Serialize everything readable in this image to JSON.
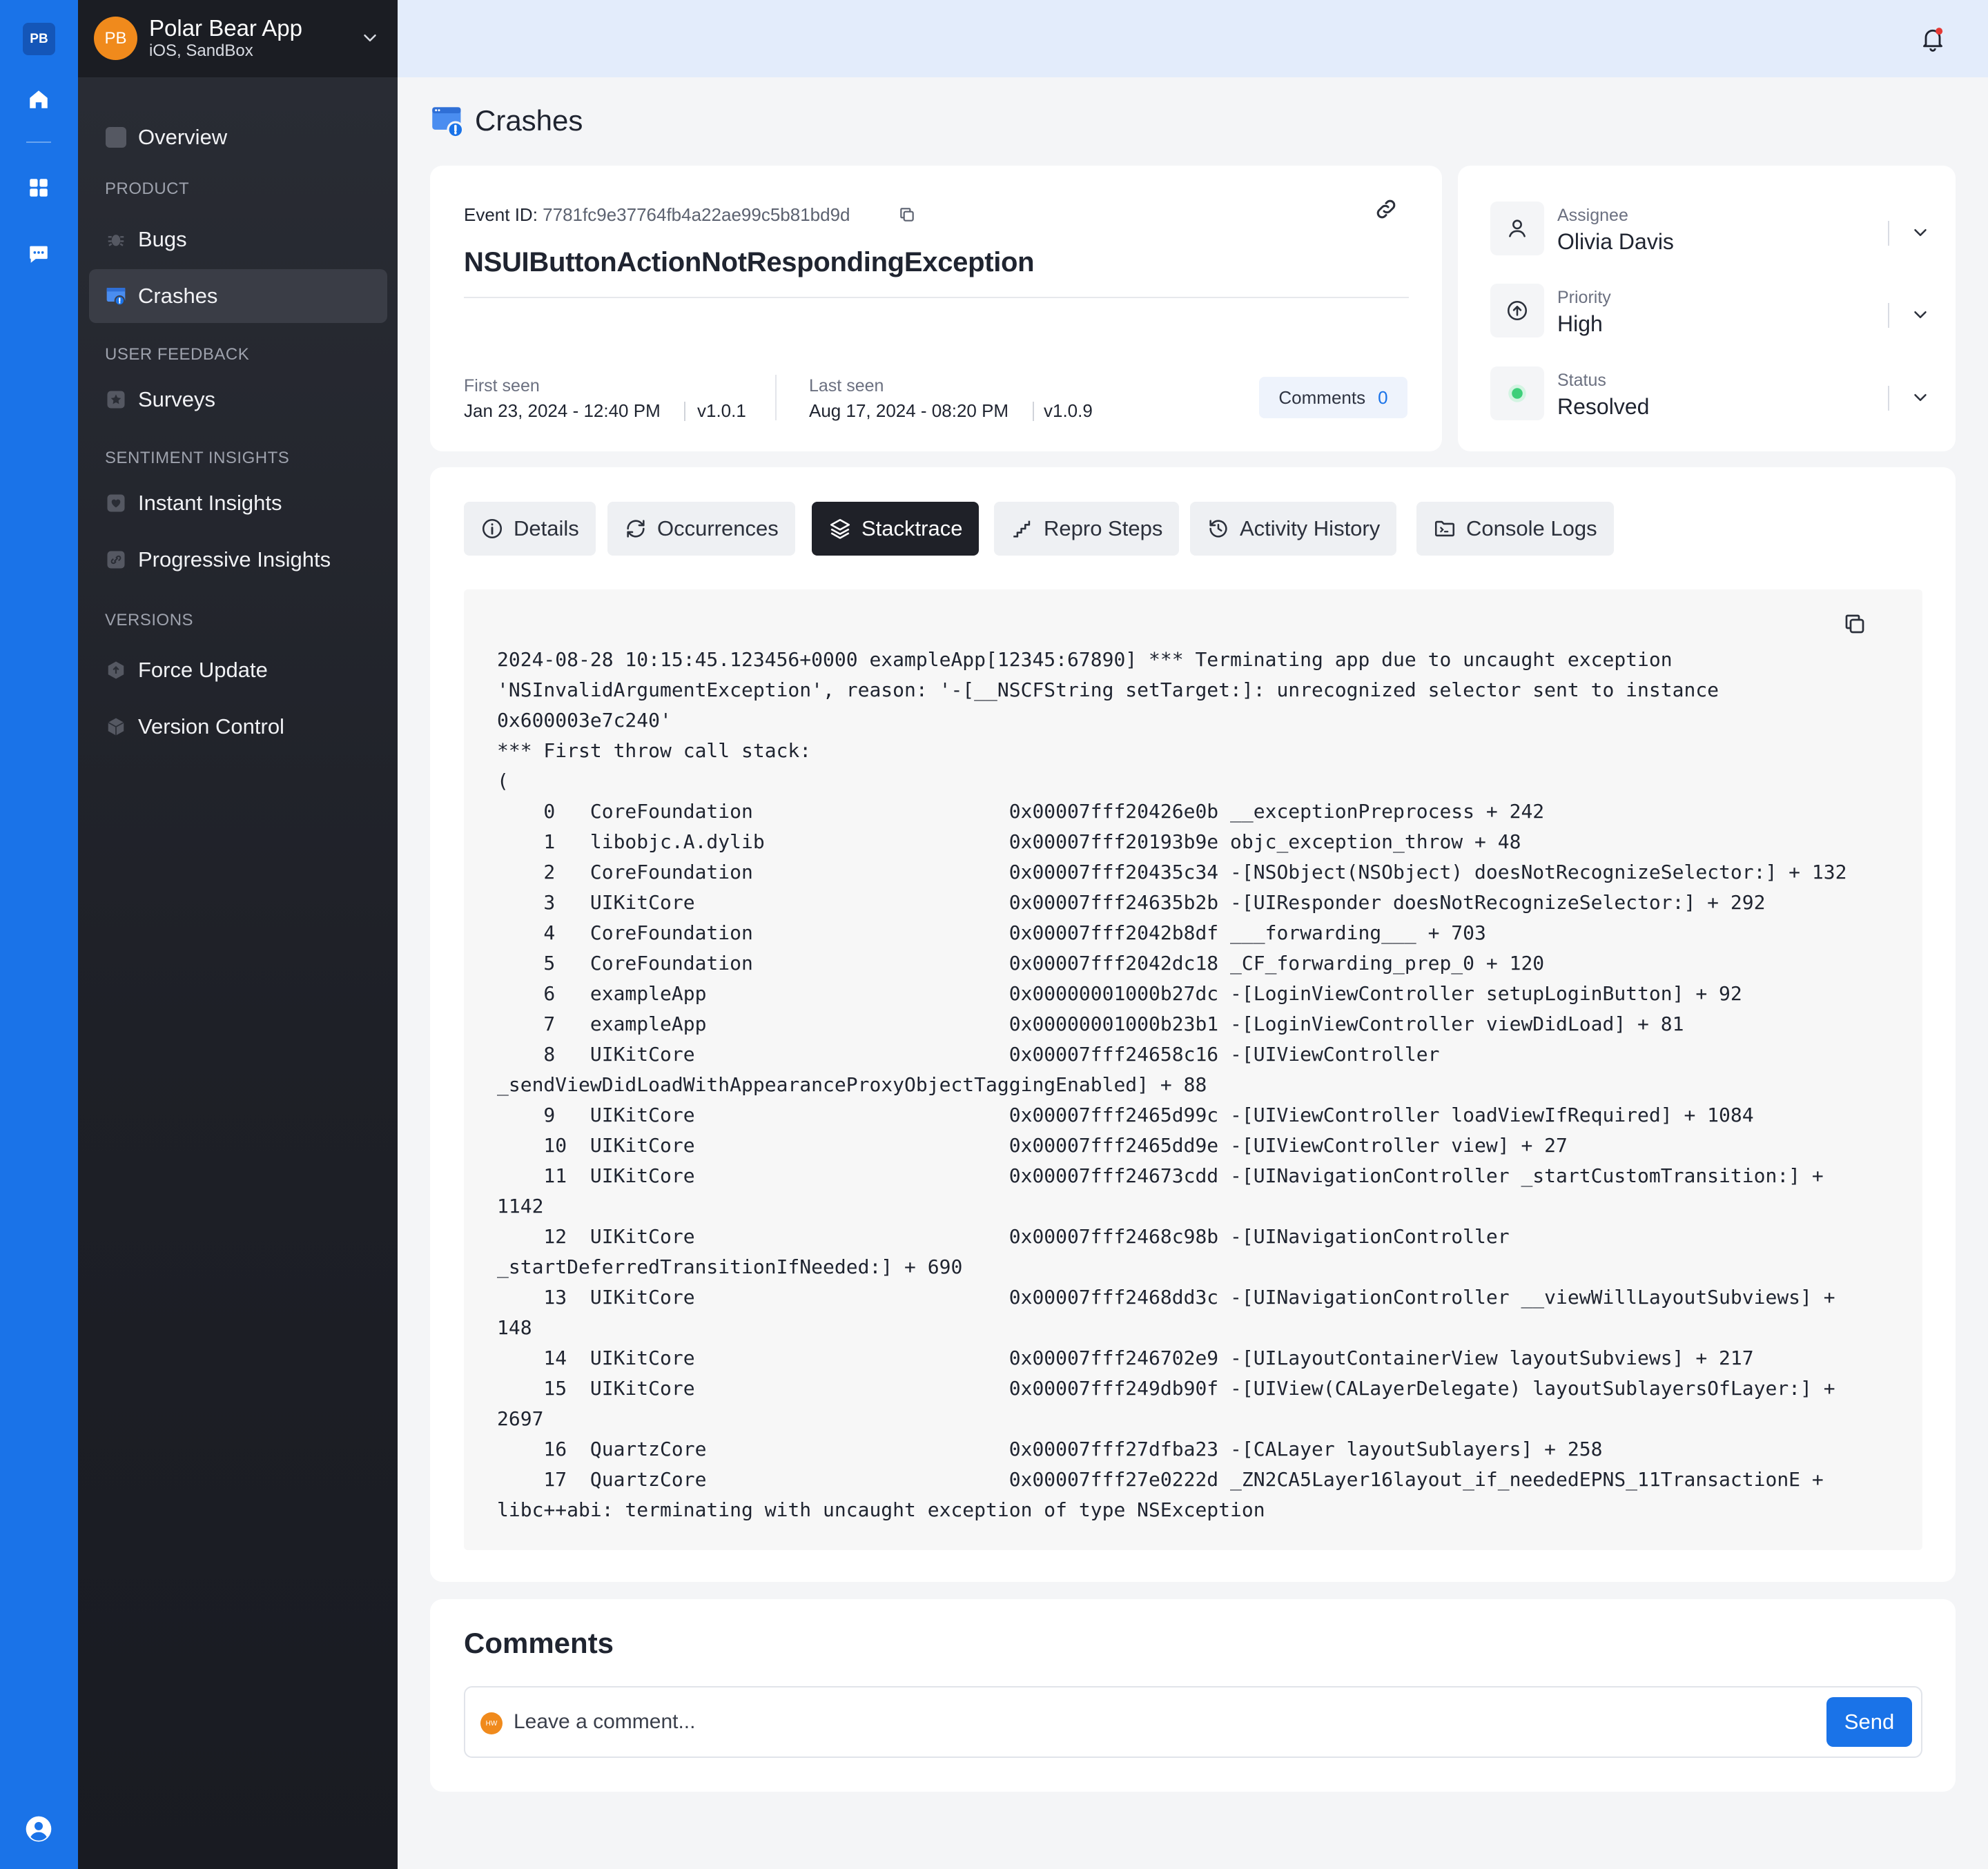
{
  "rail": {
    "logo": "PB",
    "icons": [
      "home-icon",
      "grid-icon",
      "chat-icon",
      "user-circle-icon"
    ]
  },
  "app": {
    "avatar": "PB",
    "name": "Polar Bear App",
    "sub": "iOS, SandBox"
  },
  "nav": {
    "overview": "Overview",
    "section_product": "PRODUCT",
    "bugs": "Bugs",
    "crashes": "Crashes",
    "section_feedback": "USER FEEDBACK",
    "surveys": "Surveys",
    "section_sentiment": "SENTIMENT INSIGHTS",
    "instant": "Instant Insights",
    "progressive": "Progressive Insights",
    "section_versions": "VERSIONS",
    "force_update": "Force Update",
    "version_control": "Version Control"
  },
  "page": {
    "title": "Crashes"
  },
  "event": {
    "id_label": "Event ID:",
    "id_value": "7781fc9e37764fb4a22ae99c5b81bd9d",
    "title": "NSUIButtonActionNotRespondingException",
    "first_seen_label": "First seen",
    "first_seen_date": "Jan 23, 2024 - 12:40 PM",
    "first_seen_version": "v1.0.1",
    "last_seen_label": "Last seen",
    "last_seen_date": "Aug 17, 2024 - 08:20 PM",
    "last_seen_version": "v1.0.9",
    "comments_label": "Comments",
    "comments_count": "0"
  },
  "meta": {
    "assignee_label": "Assignee",
    "assignee_value": "Olivia Davis",
    "priority_label": "Priority",
    "priority_value": "High",
    "status_label": "Status",
    "status_value": "Resolved",
    "status_color": "#3ecf7a"
  },
  "tabs": {
    "details": "Details",
    "occurrences": "Occurrences",
    "stacktrace": "Stacktrace",
    "repro": "Repro Steps",
    "activity": "Activity History",
    "console": "Console Logs"
  },
  "stacktrace": "2024-08-28 10:15:45.123456+0000 exampleApp[12345:67890] *** Terminating app due to uncaught exception\n'NSInvalidArgumentException', reason: '-[__NSCFString setTarget:]: unrecognized selector sent to instance\n0x600003e7c240'\n*** First throw call stack:\n(\n    0   CoreFoundation                      0x00007fff20426e0b __exceptionPreprocess + 242\n    1   libobjc.A.dylib                     0x00007fff20193b9e objc_exception_throw + 48\n    2   CoreFoundation                      0x00007fff20435c34 -[NSObject(NSObject) doesNotRecognizeSelector:] + 132\n    3   UIKitCore                           0x00007fff24635b2b -[UIResponder doesNotRecognizeSelector:] + 292\n    4   CoreFoundation                      0x00007fff2042b8df ___forwarding___ + 703\n    5   CoreFoundation                      0x00007fff2042dc18 _CF_forwarding_prep_0 + 120\n    6   exampleApp                          0x00000001000b27dc -[LoginViewController setupLoginButton] + 92\n    7   exampleApp                          0x00000001000b23b1 -[LoginViewController viewDidLoad] + 81\n    8   UIKitCore                           0x00007fff24658c16 -[UIViewController\n_sendViewDidLoadWithAppearanceProxyObjectTaggingEnabled] + 88\n    9   UIKitCore                           0x00007fff2465d99c -[UIViewController loadViewIfRequired] + 1084\n    10  UIKitCore                           0x00007fff2465dd9e -[UIViewController view] + 27\n    11  UIKitCore                           0x00007fff24673cdd -[UINavigationController _startCustomTransition:] +\n1142\n    12  UIKitCore                           0x00007fff2468c98b -[UINavigationController\n_startDeferredTransitionIfNeeded:] + 690\n    13  UIKitCore                           0x00007fff2468dd3c -[UINavigationController __viewWillLayoutSubviews] +\n148\n    14  UIKitCore                           0x00007fff246702e9 -[UILayoutContainerView layoutSubviews] + 217\n    15  UIKitCore                           0x00007fff249db90f -[UIView(CALayerDelegate) layoutSublayersOfLayer:] +\n2697\n    16  QuartzCore                          0x00007fff27dfba23 -[CALayer layoutSublayers] + 258\n    17  QuartzCore                          0x00007fff27e0222d _ZN2CA5Layer16layout_if_neededEPNS_11TransactionE +\nlibc++abi: terminating with uncaught exception of type NSException",
  "comments": {
    "title": "Comments",
    "avatar": "HW",
    "placeholder": "Leave a comment...",
    "send": "Send"
  }
}
